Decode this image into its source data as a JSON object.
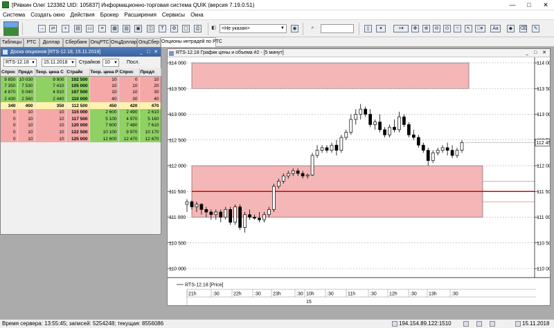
{
  "window": {
    "title": "[Рявкин Олег 123382 UID: 105837] Информационно-торговая система QUIK (версия 7.19.0.51)",
    "controls": [
      "—",
      "□",
      "✕"
    ]
  },
  "menu": [
    "Система",
    "Создать окно",
    "Действия",
    "Брокер",
    "Расширения",
    "Сервисы",
    "Окна"
  ],
  "toolbar": {
    "account_select": "<Не указан>"
  },
  "tabs": [
    "Таблицы",
    "РТС",
    "Доллар",
    "Сбербанк",
    "ОпцРТС",
    "ОпцДоллар",
    "ОпцСбер",
    "Опционы интрадей по РТС"
  ],
  "options_panel": {
    "title": "Доска опционов [RTS-12.18, 15.11.2018]",
    "instrument": "RTS-12.18",
    "date": "15.11.2018",
    "strikes_label": "Страйков",
    "strikes_count": "10",
    "last_label": "Посл.",
    "columns": [
      "Спрос",
      "Предл",
      "Теор. цена С",
      "Страйк",
      "Теор. цена Р",
      "Спрос",
      "Предл"
    ],
    "rows": [
      {
        "type": "call",
        "cells": [
          "9 850",
          "10 030",
          "9 900",
          "102 500",
          "10",
          "0",
          "10"
        ]
      },
      {
        "type": "call",
        "cells": [
          "7 350",
          "7 530",
          "7 410",
          "105 000",
          "10",
          "10",
          "20"
        ]
      },
      {
        "type": "call",
        "cells": [
          "4 870",
          "5 040",
          "4 910",
          "107 500",
          "10",
          "10",
          "30"
        ]
      },
      {
        "type": "call",
        "cells": [
          "2 430",
          "2 560",
          "2 440",
          "110 000",
          "40",
          "30",
          "40"
        ]
      },
      {
        "type": "mid",
        "cells": [
          "340",
          "400",
          "350",
          "112 500",
          "450",
          "420",
          "470"
        ]
      },
      {
        "type": "put",
        "cells": [
          "0",
          "10",
          "10",
          "115 000",
          "2 600",
          "2 490",
          "2 610"
        ]
      },
      {
        "type": "put",
        "cells": [
          "0",
          "10",
          "10",
          "117 500",
          "5 100",
          "4 970",
          "5 160"
        ]
      },
      {
        "type": "put",
        "cells": [
          "0",
          "10",
          "10",
          "120 000",
          "7 600",
          "7 480",
          "7 610"
        ]
      },
      {
        "type": "put",
        "cells": [
          "0",
          "10",
          "10",
          "122 500",
          "10 100",
          "9 970",
          "10 170"
        ]
      },
      {
        "type": "put",
        "cells": [
          "0",
          "10",
          "10",
          "125 000",
          "12 600",
          "12 470",
          "12 670"
        ]
      }
    ]
  },
  "chart_window": {
    "title": "RTS-12.18 График цены и объема #2 - [5 минут]",
    "legend": "RTS-12.18 [Price]",
    "current_price_label": "112 450",
    "day_label": "15"
  },
  "chart_data": {
    "type": "candlestick",
    "instrument": "RTS-12.18",
    "timeframe": "5 минут",
    "ylim": [
      110000,
      114000
    ],
    "y_ticks": [
      {
        "value": 114000,
        "label": "114 000"
      },
      {
        "value": 113500,
        "label": "113 500"
      },
      {
        "value": 113000,
        "label": "113 000"
      },
      {
        "value": 112500,
        "label": "112 500"
      },
      {
        "value": 112000,
        "label": "112 000"
      },
      {
        "value": 111500,
        "label": "111 500"
      },
      {
        "value": 111000,
        "label": "111 000"
      },
      {
        "value": 110500,
        "label": "110 500"
      },
      {
        "value": 110000,
        "label": "110 000"
      }
    ],
    "x_labels": [
      "21h",
      ":30",
      "22h",
      ":30",
      "23h",
      ":30",
      "10h",
      ":30",
      "11h",
      ":30",
      "12h",
      ":30",
      "13h",
      ":30"
    ],
    "zones": [
      {
        "from": 113500,
        "to": 114000,
        "color": "#f4b6b6"
      },
      {
        "from": 111000,
        "to": 112000,
        "color": "#f4b6b6"
      }
    ],
    "red_level": 111500,
    "thin_levels": [
      111700,
      111300
    ],
    "last_price": 112450,
    "candles": [
      {
        "o": 111250,
        "h": 111350,
        "l": 111100,
        "c": 111300
      },
      {
        "o": 111300,
        "h": 111330,
        "l": 111150,
        "c": 111200
      },
      {
        "o": 111200,
        "h": 111300,
        "l": 111100,
        "c": 111250
      },
      {
        "o": 111250,
        "h": 111270,
        "l": 111050,
        "c": 111150
      },
      {
        "o": 111150,
        "h": 111200,
        "l": 111000,
        "c": 111100
      },
      {
        "o": 111100,
        "h": 111150,
        "l": 110950,
        "c": 111050
      },
      {
        "o": 111050,
        "h": 111150,
        "l": 110950,
        "c": 111100
      },
      {
        "o": 111100,
        "h": 111150,
        "l": 110900,
        "c": 111000
      },
      {
        "o": 111000,
        "h": 111200,
        "l": 110950,
        "c": 111150
      },
      {
        "o": 111150,
        "h": 111200,
        "l": 110850,
        "c": 110900
      },
      {
        "o": 110900,
        "h": 111250,
        "l": 110850,
        "c": 111200
      },
      {
        "o": 111200,
        "h": 111250,
        "l": 110750,
        "c": 110800
      },
      {
        "o": 110800,
        "h": 111100,
        "l": 110700,
        "c": 111050
      },
      {
        "o": 111050,
        "h": 111150,
        "l": 110950,
        "c": 111000
      },
      {
        "o": 111000,
        "h": 111050,
        "l": 110950,
        "c": 110980
      },
      {
        "o": 110980,
        "h": 111100,
        "l": 110900,
        "c": 110950
      },
      {
        "o": 110950,
        "h": 111100,
        "l": 110900,
        "c": 111050
      },
      {
        "o": 111050,
        "h": 111200,
        "l": 111000,
        "c": 111150
      },
      {
        "o": 111150,
        "h": 111650,
        "l": 111100,
        "c": 111600
      },
      {
        "o": 111600,
        "h": 111750,
        "l": 111550,
        "c": 111700
      },
      {
        "o": 111700,
        "h": 111850,
        "l": 111650,
        "c": 111800
      },
      {
        "o": 111800,
        "h": 111900,
        "l": 111750,
        "c": 111850
      },
      {
        "o": 111850,
        "h": 111950,
        "l": 111800,
        "c": 111900
      },
      {
        "o": 111900,
        "h": 111950,
        "l": 111800,
        "c": 111850
      },
      {
        "o": 111850,
        "h": 111900,
        "l": 111750,
        "c": 111800
      },
      {
        "o": 111800,
        "h": 111850,
        "l": 111750,
        "c": 111820
      },
      {
        "o": 111820,
        "h": 112250,
        "l": 111800,
        "c": 112200
      },
      {
        "o": 112200,
        "h": 112400,
        "l": 112150,
        "c": 112300
      },
      {
        "o": 112300,
        "h": 112400,
        "l": 112250,
        "c": 112350
      },
      {
        "o": 112350,
        "h": 112400,
        "l": 112250,
        "c": 112300
      },
      {
        "o": 112300,
        "h": 112450,
        "l": 112250,
        "c": 112400
      },
      {
        "o": 112400,
        "h": 112500,
        "l": 112200,
        "c": 112300
      },
      {
        "o": 112300,
        "h": 112600,
        "l": 112250,
        "c": 112550
      },
      {
        "o": 112550,
        "h": 112700,
        "l": 112500,
        "c": 112650
      },
      {
        "o": 112650,
        "h": 113000,
        "l": 112600,
        "c": 112900
      },
      {
        "o": 112900,
        "h": 113100,
        "l": 112800,
        "c": 113000
      },
      {
        "o": 113000,
        "h": 113200,
        "l": 112900,
        "c": 113100
      },
      {
        "o": 113100,
        "h": 113150,
        "l": 112950,
        "c": 113000
      },
      {
        "o": 113000,
        "h": 113100,
        "l": 112750,
        "c": 112800
      },
      {
        "o": 112800,
        "h": 112900,
        "l": 112700,
        "c": 112850
      },
      {
        "o": 112850,
        "h": 113000,
        "l": 112650,
        "c": 112700
      },
      {
        "o": 112700,
        "h": 112750,
        "l": 112550,
        "c": 112600
      },
      {
        "o": 112600,
        "h": 112800,
        "l": 112550,
        "c": 112750
      },
      {
        "o": 112750,
        "h": 112900,
        "l": 112650,
        "c": 112700
      },
      {
        "o": 112700,
        "h": 113050,
        "l": 112650,
        "c": 112950
      },
      {
        "o": 112950,
        "h": 113000,
        "l": 112750,
        "c": 112800
      },
      {
        "o": 112800,
        "h": 112850,
        "l": 112550,
        "c": 112600
      },
      {
        "o": 112600,
        "h": 112700,
        "l": 112500,
        "c": 112550
      },
      {
        "o": 112550,
        "h": 112600,
        "l": 112350,
        "c": 112400
      },
      {
        "o": 112400,
        "h": 112450,
        "l": 112250,
        "c": 112300
      },
      {
        "o": 112300,
        "h": 112350,
        "l": 112000,
        "c": 112100
      },
      {
        "o": 112100,
        "h": 112300,
        "l": 112050,
        "c": 112250
      },
      {
        "o": 112250,
        "h": 112350,
        "l": 112200,
        "c": 112300
      },
      {
        "o": 112300,
        "h": 112400,
        "l": 112250,
        "c": 112350
      },
      {
        "o": 112350,
        "h": 112450,
        "l": 112200,
        "c": 112300
      },
      {
        "o": 112300,
        "h": 112400,
        "l": 112150,
        "c": 112200
      },
      {
        "o": 112200,
        "h": 112350,
        "l": 112150,
        "c": 112300
      },
      {
        "o": 112300,
        "h": 112500,
        "l": 112250,
        "c": 112450
      }
    ]
  },
  "status": {
    "text": "Время сервера: 13:55:45; записей: 5254248; текущая: 8556086",
    "ip": "194.154.89.122:1510",
    "date": "15.11.2018"
  }
}
